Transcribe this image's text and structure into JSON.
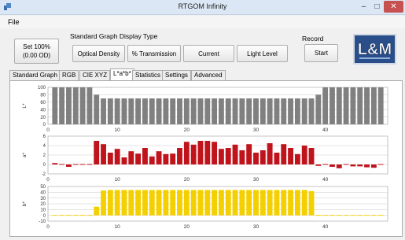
{
  "window": {
    "title": "RTGOM Infinity",
    "min_glyph": "–",
    "max_glyph": "□",
    "close_glyph": "✕"
  },
  "menu": {
    "file": "File"
  },
  "set_button": {
    "line1": "Set 100%",
    "line2": "(0.00 OD)"
  },
  "graph_display": {
    "label": "Standard Graph Display Type",
    "buttons": [
      "Optical Density",
      "% Transmission",
      "Current",
      "Light Level"
    ]
  },
  "record": {
    "label": "Record",
    "start": "Start"
  },
  "logo": {
    "text": "L&M"
  },
  "tabs": [
    "Standard Graph",
    "RGB",
    "CIE XYZ",
    "L*a*b*",
    "Statistics",
    "Settings",
    "Advanced"
  ],
  "active_tab": "L*a*b*",
  "colors": {
    "L": "#808080",
    "a": "#c0141c",
    "b": "#f5d000"
  },
  "chart_data": [
    {
      "type": "bar",
      "ylabel": "L*",
      "ylim": [
        0,
        100
      ],
      "yticks": [
        0,
        20,
        40,
        60,
        80,
        100
      ],
      "xticks": [
        0,
        10,
        20,
        30,
        40
      ],
      "x": [
        1,
        2,
        3,
        4,
        5,
        6,
        7,
        8,
        9,
        10,
        11,
        12,
        13,
        14,
        15,
        16,
        17,
        18,
        19,
        20,
        21,
        22,
        23,
        24,
        25,
        26,
        27,
        28,
        29,
        30,
        31,
        32,
        33,
        34,
        35,
        36,
        37,
        38,
        39,
        40,
        41,
        42,
        43,
        44,
        45,
        46,
        47,
        48
      ],
      "values": [
        100,
        100,
        100,
        100,
        100,
        100,
        80,
        70,
        70,
        70,
        70,
        70,
        70,
        70,
        70,
        70,
        70,
        70,
        70,
        70,
        70,
        70,
        70,
        70,
        70,
        70,
        70,
        70,
        70,
        70,
        70,
        70,
        70,
        70,
        70,
        70,
        70,
        70,
        80,
        100,
        100,
        100,
        100,
        100,
        100,
        100,
        100,
        100
      ]
    },
    {
      "type": "bar",
      "ylabel": "a*",
      "ylim": [
        -2,
        6
      ],
      "yticks": [
        -2,
        0,
        2,
        4,
        6
      ],
      "xticks": [
        0,
        10,
        20,
        30,
        40
      ],
      "x": [
        1,
        2,
        3,
        4,
        5,
        6,
        7,
        8,
        9,
        10,
        11,
        12,
        13,
        14,
        15,
        16,
        17,
        18,
        19,
        20,
        21,
        22,
        23,
        24,
        25,
        26,
        27,
        28,
        29,
        30,
        31,
        32,
        33,
        34,
        35,
        36,
        37,
        38,
        39,
        40,
        41,
        42,
        43,
        44,
        45,
        46,
        47,
        48
      ],
      "values": [
        0.3,
        0,
        -0.5,
        0,
        0,
        0,
        5,
        4.3,
        2.5,
        3.3,
        1.5,
        2.8,
        2.3,
        3.5,
        1.7,
        2.8,
        2.2,
        2.3,
        3.5,
        4.8,
        4.2,
        5,
        5,
        4.8,
        3.3,
        3.5,
        4.2,
        3,
        4.3,
        2.5,
        3,
        4.5,
        2.5,
        4.3,
        3.5,
        2.2,
        4,
        3.5,
        -0.3,
        0,
        -0.5,
        -0.8,
        0,
        -0.4,
        -0.4,
        -0.6,
        -0.7,
        0
      ]
    },
    {
      "type": "bar",
      "ylabel": "b*",
      "ylim": [
        -10,
        50
      ],
      "yticks": [
        -10,
        0,
        10,
        20,
        30,
        40,
        50
      ],
      "xticks": [
        0,
        10,
        20,
        30,
        40
      ],
      "x": [
        1,
        2,
        3,
        4,
        5,
        6,
        7,
        8,
        9,
        10,
        11,
        12,
        13,
        14,
        15,
        16,
        17,
        18,
        19,
        20,
        21,
        22,
        23,
        24,
        25,
        26,
        27,
        28,
        29,
        30,
        31,
        32,
        33,
        34,
        35,
        36,
        37,
        38,
        39,
        40,
        41,
        42,
        43,
        44,
        45,
        46,
        47,
        48
      ],
      "values": [
        0.5,
        0.5,
        0.5,
        0.5,
        0.5,
        0.5,
        15,
        43,
        44,
        44,
        44,
        44,
        44,
        44,
        44,
        44,
        44,
        44,
        44,
        44,
        44,
        44,
        44,
        44,
        44,
        44,
        44,
        44,
        44,
        44,
        44,
        44,
        44,
        44,
        44,
        44,
        44,
        42,
        0.5,
        0.5,
        0.5,
        0.5,
        0.5,
        0.5,
        0.5,
        0.5,
        0.5,
        0.5
      ]
    }
  ]
}
